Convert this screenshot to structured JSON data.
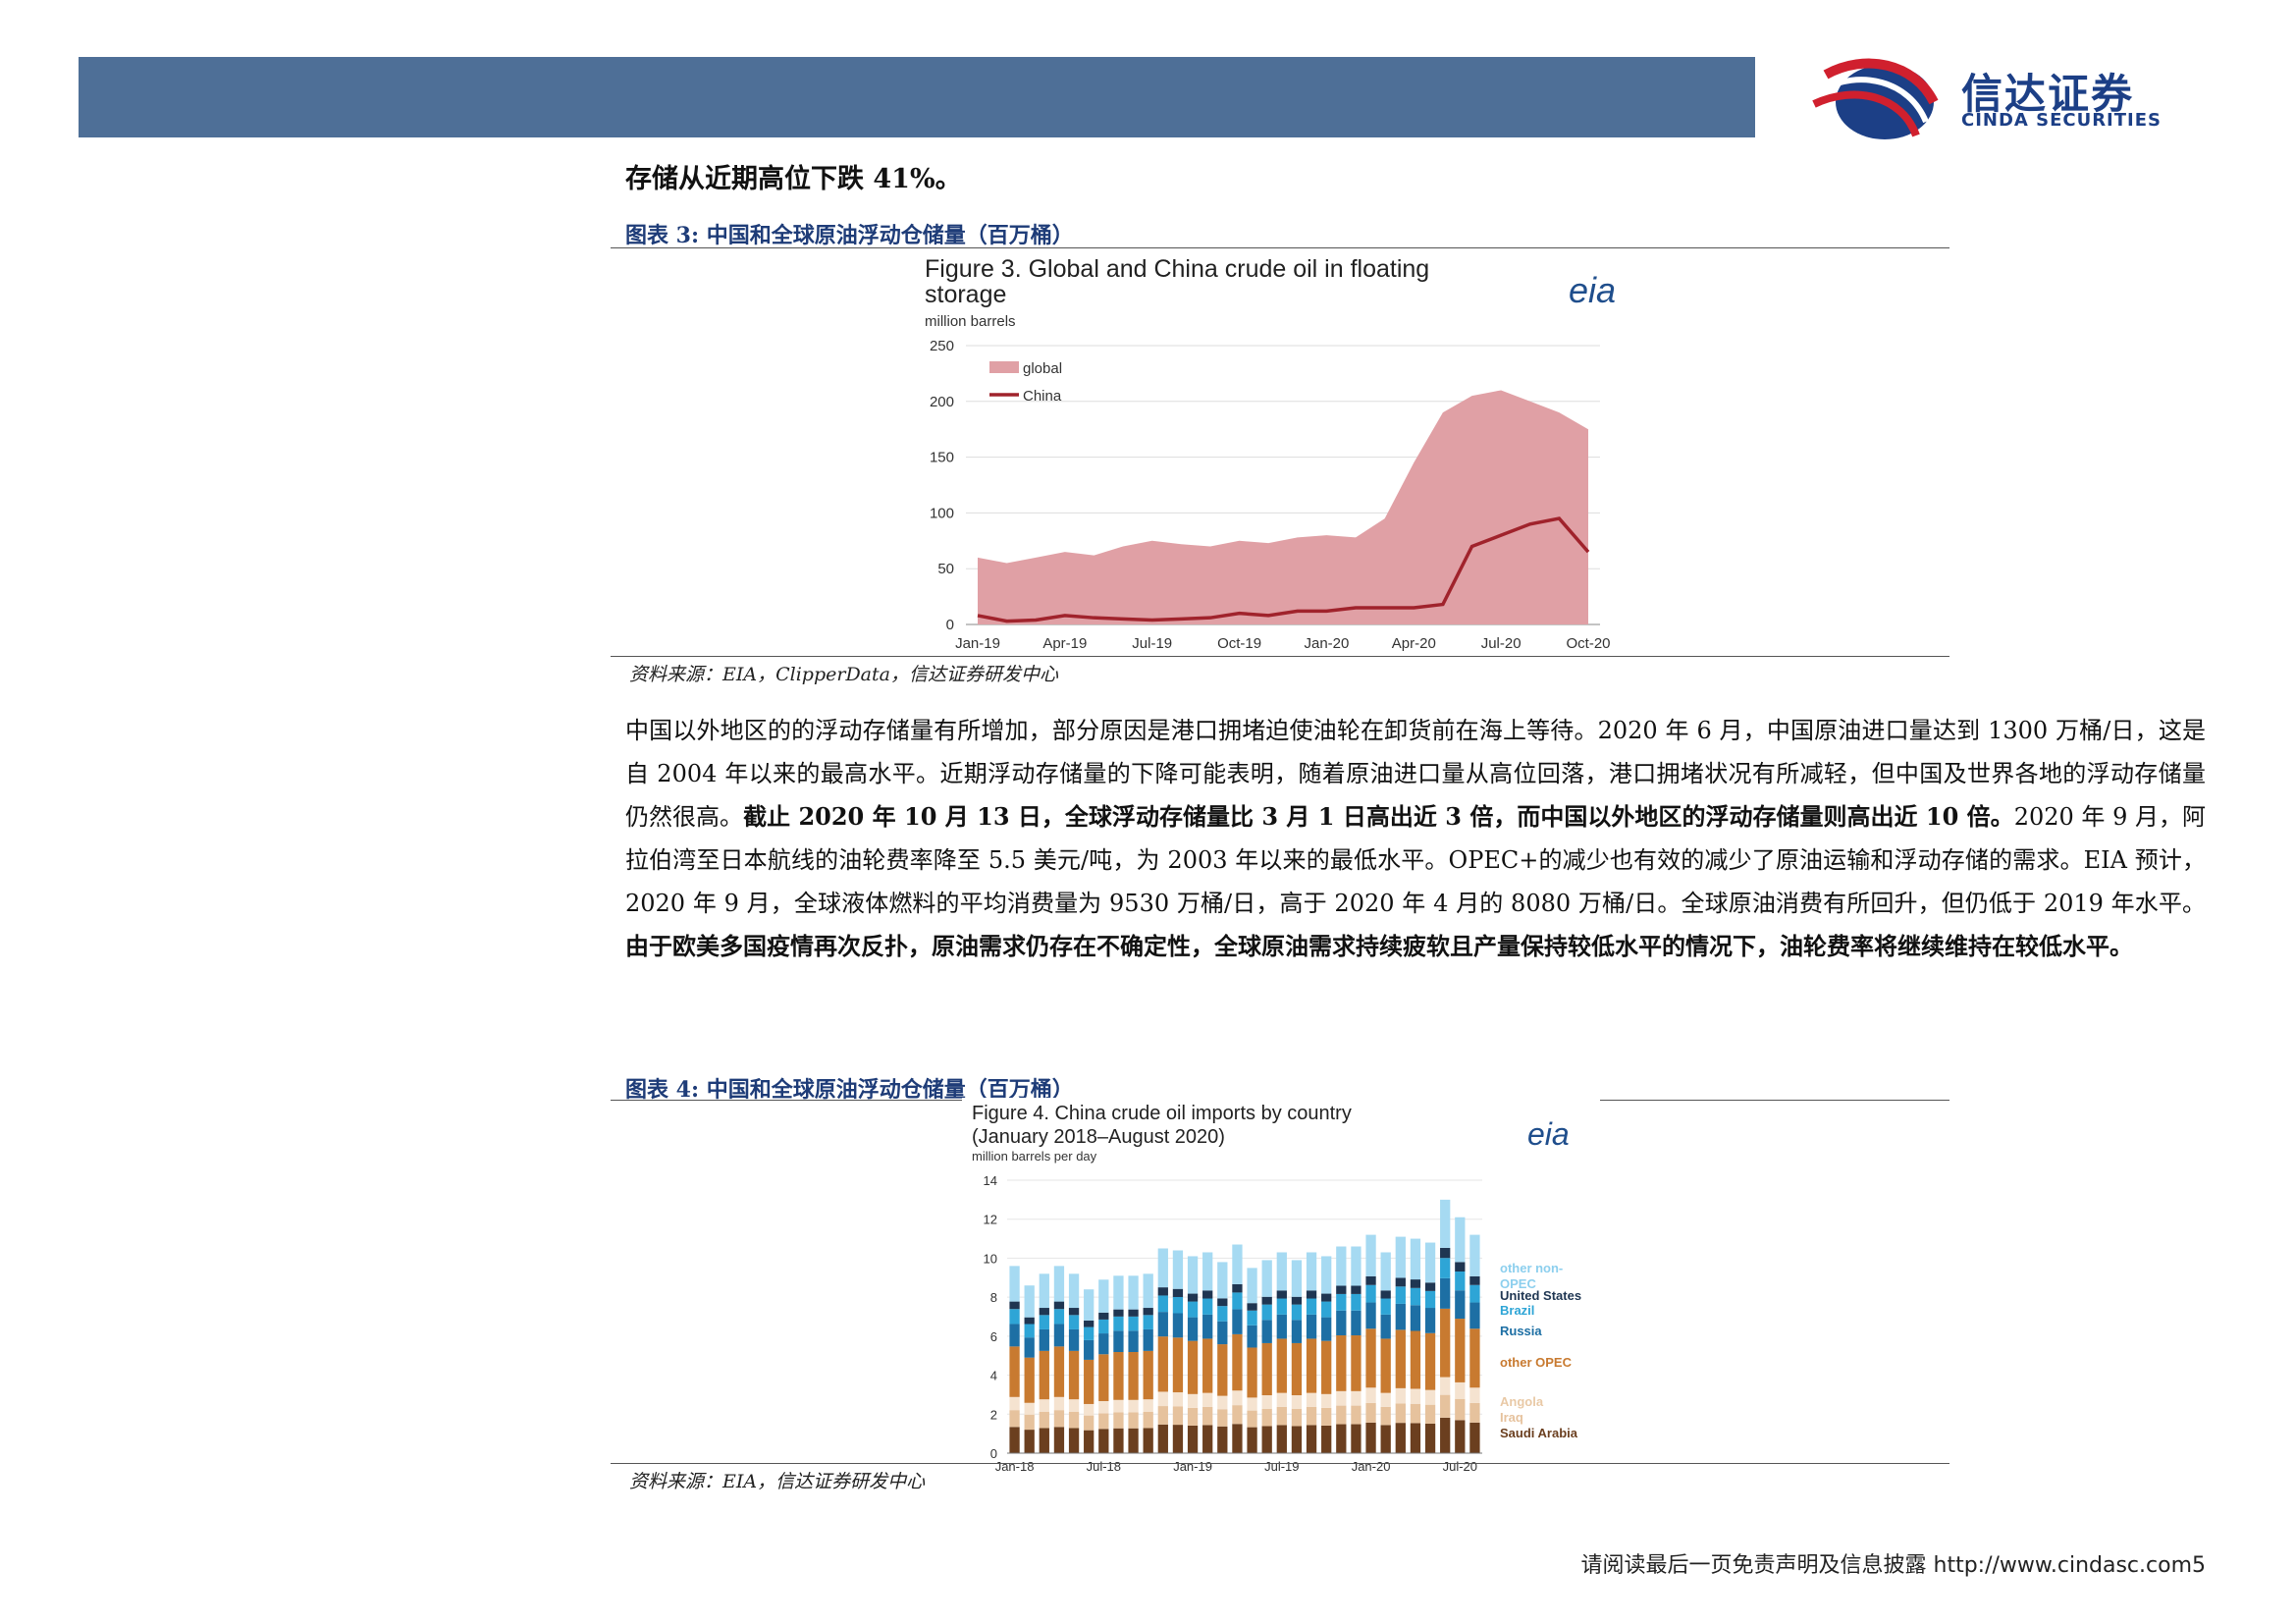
{
  "header": {
    "brand_cn": "信达证券",
    "brand_en": "CINDA SECURITIES",
    "colors": {
      "bar": "#4e6f97",
      "brand": "#1c3f86",
      "logo_red": "#d0202e"
    }
  },
  "lead_text": "存储从近期高位下跌 41%。",
  "figure3": {
    "caption": "图表 3:  中国和全球原油浮动仓储量（百万桶）",
    "source": "资料来源：EIA，ClipperData，信达证券研发中心"
  },
  "figure4": {
    "caption": "图表 4:  中国和全球原油浮动仓储量（百万桶）",
    "source": "资料来源：EIA，信达证券研发中心"
  },
  "paragraph": {
    "part1": "中国以外地区的的浮动存储量有所增加，部分原因是港口拥堵迫使油轮在卸货前在海上等待。2020 年 6 月，中国原油进口量达到 1300 万桶/日，这是自 2004 年以来的最高水平。近期浮动存储量的下降可能表明，随着原油进口量从高位回落，港口拥堵状况有所减轻，但中国及世界各地的浮动存储量仍然很高。",
    "bold1": "截止 2020 年 10 月 13 日，全球浮动存储量比 3 月 1 日高出近 3 倍，而中国以外地区的浮动存储量则高出近 10 倍。",
    "part2": "2020 年 9 月，阿拉伯湾至日本航线的油轮费率降至 5.5 美元/吨，为 2003 年以来的最低水平。OPEC+的减少也有效的减少了原油运输和浮动存储的需求。EIA 预计，2020 年 9 月，全球液体燃料的平均消费量为 9530 万桶/日，高于 2020 年 4 月的 8080 万桶/日。全球原油消费有所回升，但仍低于 2019 年水平。",
    "bold2": "由于欧美多国疫情再次反扑，原油需求仍存在不确定性，全球原油需求持续疲软且产量保持较低水平的情况下，油轮费率将继续维持在较低水平。"
  },
  "footer": {
    "text": "请阅读最后一页免责声明及信息披露  http://www.cindasc.com",
    "page": "5"
  },
  "chart_data": [
    {
      "type": "area",
      "title": "Figure 3. Global and China crude oil in floating storage",
      "subtitle": "million barrels",
      "logo": "eia",
      "x_ticks": [
        "Jan-19",
        "Apr-19",
        "Jul-19",
        "Oct-19",
        "Jan-20",
        "Apr-20",
        "Jul-20",
        "Oct-20"
      ],
      "ylim": [
        0,
        250
      ],
      "y_ticks": [
        0,
        50,
        100,
        150,
        200,
        250
      ],
      "legend": "top-left",
      "grid": true,
      "colors": {
        "global": "#e0a0a5",
        "China": "#a0232c"
      },
      "series": [
        {
          "name": "global",
          "x": [
            "Jan-19",
            "Feb-19",
            "Mar-19",
            "Apr-19",
            "May-19",
            "Jun-19",
            "Jul-19",
            "Aug-19",
            "Sep-19",
            "Oct-19",
            "Nov-19",
            "Dec-19",
            "Jan-20",
            "Feb-20",
            "Mar-20",
            "Apr-20",
            "May-20",
            "Jun-20",
            "Jul-20",
            "Aug-20",
            "Sep-20",
            "Oct-20"
          ],
          "values": [
            60,
            55,
            60,
            65,
            62,
            70,
            75,
            72,
            70,
            75,
            73,
            78,
            80,
            78,
            95,
            145,
            190,
            205,
            210,
            200,
            190,
            175
          ]
        },
        {
          "name": "China",
          "x": [
            "Jan-19",
            "Feb-19",
            "Mar-19",
            "Apr-19",
            "May-19",
            "Jun-19",
            "Jul-19",
            "Aug-19",
            "Sep-19",
            "Oct-19",
            "Nov-19",
            "Dec-19",
            "Jan-20",
            "Feb-20",
            "Mar-20",
            "Apr-20",
            "May-20",
            "Jun-20",
            "Jul-20",
            "Aug-20",
            "Sep-20",
            "Oct-20"
          ],
          "values": [
            8,
            3,
            4,
            8,
            6,
            5,
            4,
            5,
            6,
            10,
            8,
            12,
            12,
            15,
            15,
            15,
            18,
            70,
            80,
            90,
            95,
            65
          ]
        }
      ]
    },
    {
      "type": "bar",
      "title": "Figure 4. China crude oil imports by country (January 2018–August 2020)",
      "subtitle": "million barrels per day",
      "logo": "eia",
      "x_ticks": [
        "Jan-18",
        "Jul-18",
        "Jan-19",
        "Jul-19",
        "Jan-20",
        "Jul-20"
      ],
      "ylim": [
        0,
        14
      ],
      "y_ticks": [
        0,
        2,
        4,
        6,
        8,
        10,
        12,
        14
      ],
      "stacked": true,
      "legend": "right",
      "stack_order": [
        "Saudi Arabia",
        "Iraq",
        "Angola",
        "other OPEC",
        "Russia",
        "Brazil",
        "United States",
        "other non-OPEC"
      ],
      "colors": {
        "Saudi Arabia": "#6b3f1f",
        "Iraq": "#e6c29d",
        "Angola": "#f5e3d0",
        "other OPEC": "#c87a30",
        "Russia": "#1d6fa4",
        "Brazil": "#2ea5d6",
        "United States": "#1f3652",
        "other non-OPEC": "#a6daf2"
      },
      "categories": [
        "Jan-18",
        "Feb-18",
        "Mar-18",
        "Apr-18",
        "May-18",
        "Jun-18",
        "Jul-18",
        "Aug-18",
        "Sep-18",
        "Oct-18",
        "Nov-18",
        "Dec-18",
        "Jan-19",
        "Feb-19",
        "Mar-19",
        "Apr-19",
        "May-19",
        "Jun-19",
        "Jul-19",
        "Aug-19",
        "Sep-19",
        "Oct-19",
        "Nov-19",
        "Dec-19",
        "Jan-20",
        "Feb-20",
        "Mar-20",
        "Apr-20",
        "May-20",
        "Jun-20",
        "Jul-20",
        "Aug-20"
      ],
      "totals": [
        9.6,
        8.6,
        9.2,
        9.6,
        9.2,
        8.4,
        8.9,
        9.1,
        9.1,
        9.2,
        10.5,
        10.4,
        10.1,
        10.3,
        9.8,
        10.7,
        9.5,
        9.9,
        10.3,
        9.9,
        10.3,
        10.1,
        10.6,
        10.6,
        11.2,
        10.3,
        11.1,
        11.0,
        10.8,
        13.0,
        12.1,
        11.2
      ]
    }
  ]
}
